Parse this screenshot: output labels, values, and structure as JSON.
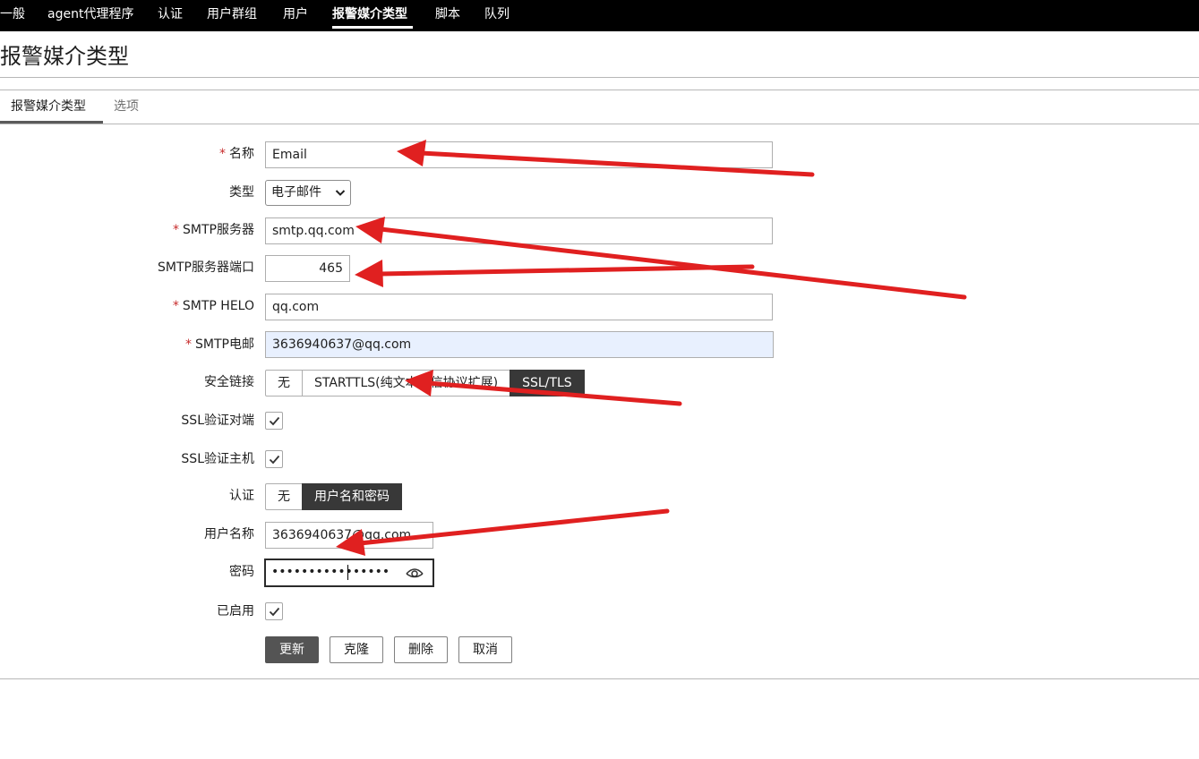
{
  "topnav": {
    "items": [
      "一般",
      "agent代理程序",
      "认证",
      "用户群组",
      "用户",
      "报警媒介类型",
      "脚本",
      "队列"
    ],
    "active_index": 5
  },
  "page": {
    "title": "报警媒介类型"
  },
  "tabs": [
    {
      "label": "报警媒介类型",
      "active": true
    },
    {
      "label": "选项",
      "active": false
    }
  ],
  "form": {
    "required_mark": "*",
    "name": {
      "label": "名称",
      "value": "Email"
    },
    "type": {
      "label": "类型",
      "value": "电子邮件"
    },
    "smtp_server": {
      "label": "SMTP服务器",
      "value": "smtp.qq.com"
    },
    "smtp_port": {
      "label": "SMTP服务器端口",
      "value": "465"
    },
    "smtp_helo": {
      "label": "SMTP HELO",
      "value": "qq.com"
    },
    "smtp_email": {
      "label": "SMTP电邮",
      "value": "3636940637@qq.com"
    },
    "security": {
      "label": "安全链接",
      "options": [
        "无",
        "STARTTLS(纯文本通信协议扩展)",
        "SSL/TLS"
      ],
      "selected": "SSL/TLS"
    },
    "ssl_verify_peer": {
      "label": "SSL验证对端",
      "checked": true
    },
    "ssl_verify_host": {
      "label": "SSL验证主机",
      "checked": true
    },
    "auth": {
      "label": "认证",
      "options": [
        "无",
        "用户名和密码"
      ],
      "selected": "用户名和密码"
    },
    "username": {
      "label": "用户名称",
      "value": "3636940637@qq.com"
    },
    "password": {
      "label": "密码",
      "value": "••••••••••••••••"
    },
    "enabled": {
      "label": "已启用",
      "checked": true
    }
  },
  "buttons": {
    "update": "更新",
    "clone": "克隆",
    "delete": "删除",
    "cancel": "取消"
  },
  "colors": {
    "nav_bg": "#000000",
    "annotation_arrow": "#e02020",
    "primary_button": "#545454",
    "segment_selected": "#383838",
    "required": "#c72c2c",
    "autofill_bg": "#e8f0fe"
  },
  "icons": {
    "type_dropdown": "chevron-down-icon",
    "password_toggle": "eye-icon",
    "checkbox": "checkmark-icon"
  }
}
